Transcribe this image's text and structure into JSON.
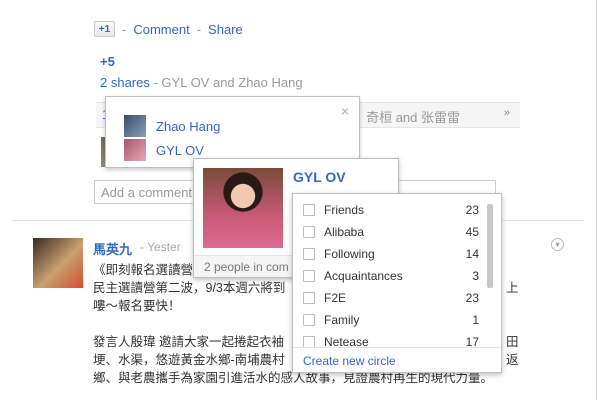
{
  "actions": {
    "plus_one": "+1",
    "comment": "Comment",
    "share": "Share",
    "sep": "-"
  },
  "shares": {
    "plus_count": "+5",
    "shares_link": "2 shares",
    "shares_rest": " - GYL OV and Zhao Hang"
  },
  "bar": {
    "num": "1",
    "names": "奇桓 and 张雷雷",
    "chevron": "»"
  },
  "comment_box": {
    "placeholder": "Add a comment"
  },
  "share_popup": {
    "close": "×",
    "people": [
      "Zhao Hang",
      "GYL OV"
    ]
  },
  "hovercard": {
    "name": "GYL OV",
    "footer": "2 people in com"
  },
  "circles": {
    "items": [
      {
        "label": "Friends",
        "count": "23"
      },
      {
        "label": "Alibaba",
        "count": "45"
      },
      {
        "label": "Following",
        "count": "14"
      },
      {
        "label": "Acquaintances",
        "count": "3"
      },
      {
        "label": "F2E",
        "count": "23"
      },
      {
        "label": "Family",
        "count": "1"
      },
      {
        "label": "Netease",
        "count": "17"
      }
    ],
    "create": "Create new circle"
  },
  "post2": {
    "author": "馬英九",
    "time": "- Yester",
    "lines": [
      "《即刻報名選讀營",
      "民主選讀營第二波，9/3本週六將到",
      "嘍～報名要快！",
      "",
      "發言人殷瑋 邀請大家一起捲起衣袖",
      "埂、水渠，悠遊黃金水鄉-南埔農村",
      "鄉、與老農攜手為家園引進活水的感人故事，見證農村再生的現代力量。"
    ],
    "right_fragments": [
      "上",
      "田",
      "返"
    ]
  }
}
